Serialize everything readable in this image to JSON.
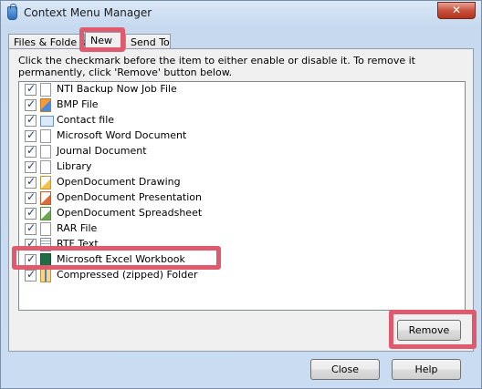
{
  "window": {
    "title": "Context Menu Manager",
    "close_label": "✕"
  },
  "tabs": [
    {
      "label": "Files & Folde s"
    },
    {
      "label": "New"
    },
    {
      "label": "Send To"
    }
  ],
  "description": "Click the checkmark before the item to either enable or disable it. To remove it permanently, click 'Remove' button below.",
  "list": {
    "items": [
      {
        "label": "NTI Backup Now Job File",
        "checked": true,
        "icon": "blank-document-icon"
      },
      {
        "label": "BMP File",
        "checked": true,
        "icon": "bitmap-image-icon"
      },
      {
        "label": "Contact file",
        "checked": true,
        "icon": "contact-card-icon"
      },
      {
        "label": "Microsoft Word Document",
        "checked": true,
        "icon": "blank-document-icon"
      },
      {
        "label": "Journal Document",
        "checked": true,
        "icon": "blank-document-icon"
      },
      {
        "label": "Library",
        "checked": true,
        "icon": "blank-document-icon"
      },
      {
        "label": "OpenDocument Drawing",
        "checked": true,
        "icon": "odg-document-icon"
      },
      {
        "label": "OpenDocument Presentation",
        "checked": true,
        "icon": "odp-document-icon"
      },
      {
        "label": "OpenDocument Spreadsheet",
        "checked": true,
        "icon": "ods-document-icon"
      },
      {
        "label": "RAR File",
        "checked": true,
        "icon": "blank-document-icon"
      },
      {
        "label": "RTF Text",
        "checked": true,
        "icon": "rtf-document-icon"
      },
      {
        "label": "Microsoft Excel Workbook",
        "checked": true,
        "icon": "excel-workbook-icon"
      },
      {
        "label": "Compressed (zipped) Folder",
        "checked": true,
        "icon": "zip-folder-icon"
      }
    ]
  },
  "buttons": {
    "remove": "Remove",
    "close": "Close",
    "help": "Help"
  },
  "colors": {
    "highlight": "#e05a6e"
  }
}
